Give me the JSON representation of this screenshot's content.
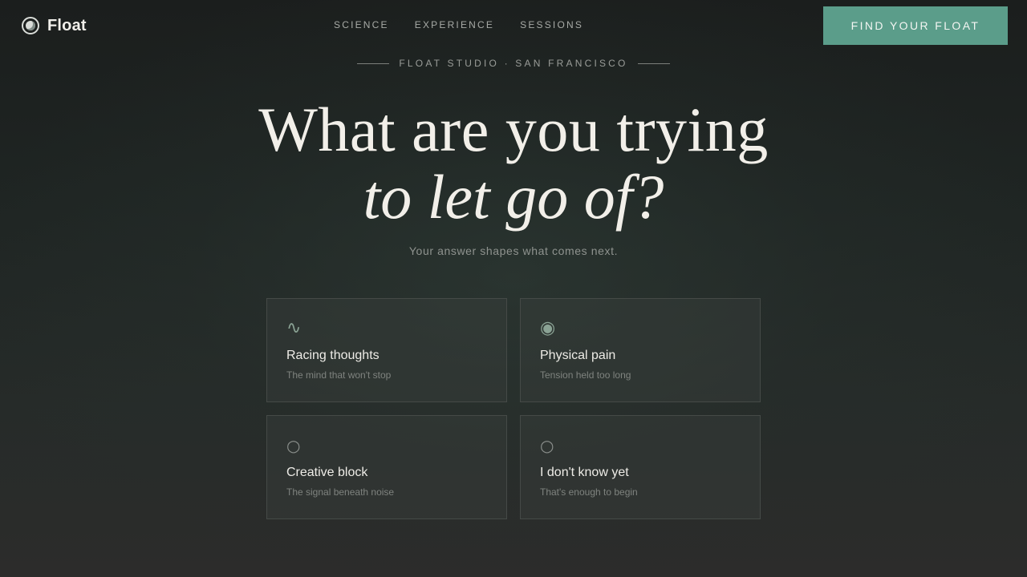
{
  "header": {
    "brand": "Float",
    "nav": [
      {
        "label": "SCIENCE"
      },
      {
        "label": "EXPERIENCE"
      },
      {
        "label": "SESSIONS"
      }
    ],
    "cta_label": "FIND YOUR FLOAT"
  },
  "hero": {
    "eyebrow": "FLOAT STUDIO · SAN FRANCISCO",
    "headline_line1": "What are you trying",
    "headline_line2": "to let go of?",
    "subhead": "Your answer shapes what comes next."
  },
  "options": [
    {
      "icon": "∿",
      "icon_name": "wave-icon",
      "title": "Racing thoughts",
      "desc": "The mind that won't stop"
    },
    {
      "icon": "◉",
      "icon_name": "target-icon",
      "title": "Physical pain",
      "desc": "Tension held too long"
    },
    {
      "icon": "○",
      "icon_name": "circle-icon",
      "title": "Creative block",
      "desc": "The signal beneath noise"
    },
    {
      "icon": "○",
      "icon_name": "circle-icon",
      "title": "I don't know yet",
      "desc": "That's enough to begin"
    }
  ],
  "colors": {
    "accent": "#5b9d8a",
    "icon_accent": "#8aa294",
    "background_top": "#1b1e1d",
    "background_bottom": "#2c2c2b"
  }
}
